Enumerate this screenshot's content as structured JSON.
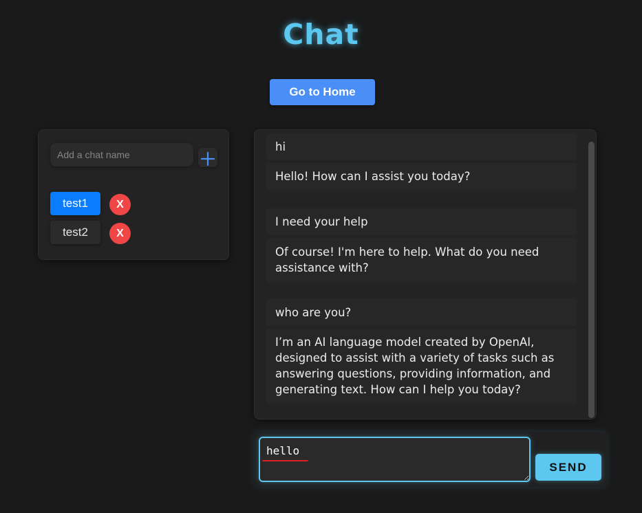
{
  "page": {
    "title": "Chat",
    "accent_color": "#5cc7ef"
  },
  "header": {
    "home_button_label": "Go to Home",
    "home_button_color": "#4a8ef7"
  },
  "sidebar": {
    "chat_name_placeholder": "Add a chat name",
    "chat_name_value": "",
    "add_icon": "plus-icon",
    "chats": [
      {
        "label": "test1",
        "active": true,
        "delete_label": "X"
      },
      {
        "label": "test2",
        "active": false,
        "delete_label": "X"
      }
    ]
  },
  "conversation": {
    "messages": [
      {
        "role": "user",
        "text": "hi"
      },
      {
        "role": "assistant",
        "text": "Hello! How can I assist you today?"
      },
      {
        "role": "user",
        "text": "I need your help"
      },
      {
        "role": "assistant",
        "text": "Of course! I'm here to help. What do you need assistance with?"
      },
      {
        "role": "user",
        "text": "who are you?"
      },
      {
        "role": "assistant",
        "text": "I’m an AI language model created by OpenAI, designed to assist with a variety of tasks such as answering questions, providing information, and generating text. How can I help you today?"
      }
    ]
  },
  "composer": {
    "message_value": "hello",
    "send_label": "SEND"
  }
}
